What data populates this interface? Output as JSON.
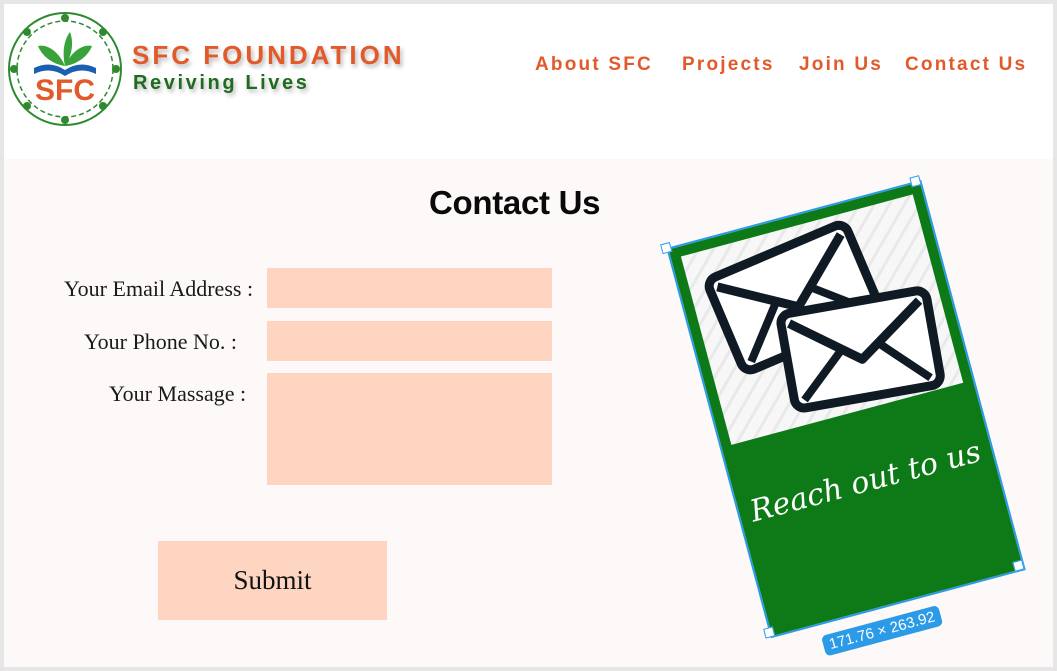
{
  "header": {
    "logo_text": "SFC",
    "brand_title": "SFC FOUNDATION",
    "brand_tagline": "Reviving Lives",
    "nav": [
      {
        "label": "About SFC"
      },
      {
        "label": "Projects"
      },
      {
        "label": "Join Us"
      },
      {
        "label": "Contact Us"
      }
    ]
  },
  "main": {
    "title": "Contact Us",
    "form": {
      "email_label": "Your Email Address :",
      "email_value": "",
      "phone_label": "Your Phone No.  :",
      "phone_value": "",
      "message_label": "Your Massage :",
      "message_value": "",
      "submit_label": "Submit"
    }
  },
  "card": {
    "caption": "Reach out to us",
    "dimensions": "171.76 × 263.92",
    "icons": [
      "envelope-icon",
      "envelope-icon"
    ]
  },
  "colors": {
    "brand_orange": "#e25a2a",
    "brand_green": "#1f6b1f",
    "field_fill": "#fdd5c0",
    "card_green": "#0d7a17",
    "selection_blue": "#2b9be8"
  }
}
